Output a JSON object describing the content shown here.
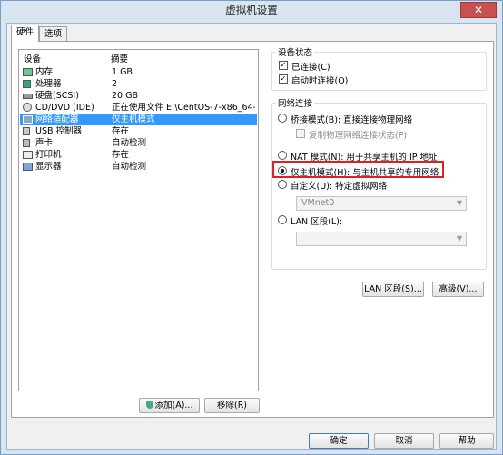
{
  "window": {
    "title": "虚拟机设置",
    "close_glyph": "✕"
  },
  "tabs": [
    {
      "label": "硬件"
    },
    {
      "label": "选项"
    }
  ],
  "device_list": {
    "col_device": "设备",
    "col_summary": "摘要",
    "items": [
      {
        "name": "内存",
        "summary": "1 GB",
        "icon": "memory-icon"
      },
      {
        "name": "处理器",
        "summary": "2",
        "icon": "cpu-icon"
      },
      {
        "name": "硬盘(SCSI)",
        "summary": "20 GB",
        "icon": "hard-disk-icon"
      },
      {
        "name": "CD/DVD (IDE)",
        "summary": "正在使用文件 E:\\CentOS-7-x86_64-...",
        "icon": "cd-dvd-icon"
      },
      {
        "name": "网络适配器",
        "summary": "仅主机模式",
        "icon": "network-adapter-icon"
      },
      {
        "name": "USB 控制器",
        "summary": "存在",
        "icon": "usb-icon"
      },
      {
        "name": "声卡",
        "summary": "自动检测",
        "icon": "sound-card-icon"
      },
      {
        "name": "打印机",
        "summary": "存在",
        "icon": "printer-icon"
      },
      {
        "name": "显示器",
        "summary": "自动检测",
        "icon": "display-icon"
      }
    ],
    "add_button": "添加(A)...",
    "remove_button": "移除(R)"
  },
  "device_status": {
    "title": "设备状态",
    "connected": "已连接(C)",
    "connect_at_power_on": "启动时连接(O)"
  },
  "network": {
    "title": "网络连接",
    "bridged": "桥接模式(B): 直接连接物理网络",
    "replicate": "复制物理网络连接状态(P)",
    "nat": "NAT 模式(N): 用于共享主机的 IP 地址",
    "host_only": "仅主机模式(H): 与主机共享的专用网络",
    "custom": "自定义(U): 特定虚拟网络",
    "vmnet_value": "VMnet0",
    "lan_segment": "LAN 区段(L):",
    "lan_segment_button": "LAN 区段(S)...",
    "advanced_button": "高级(V)..."
  },
  "footer": {
    "ok": "确定",
    "cancel": "取消",
    "help": "帮助"
  },
  "colors": {
    "selection": "#3399ff",
    "highlight": "#e02020"
  }
}
